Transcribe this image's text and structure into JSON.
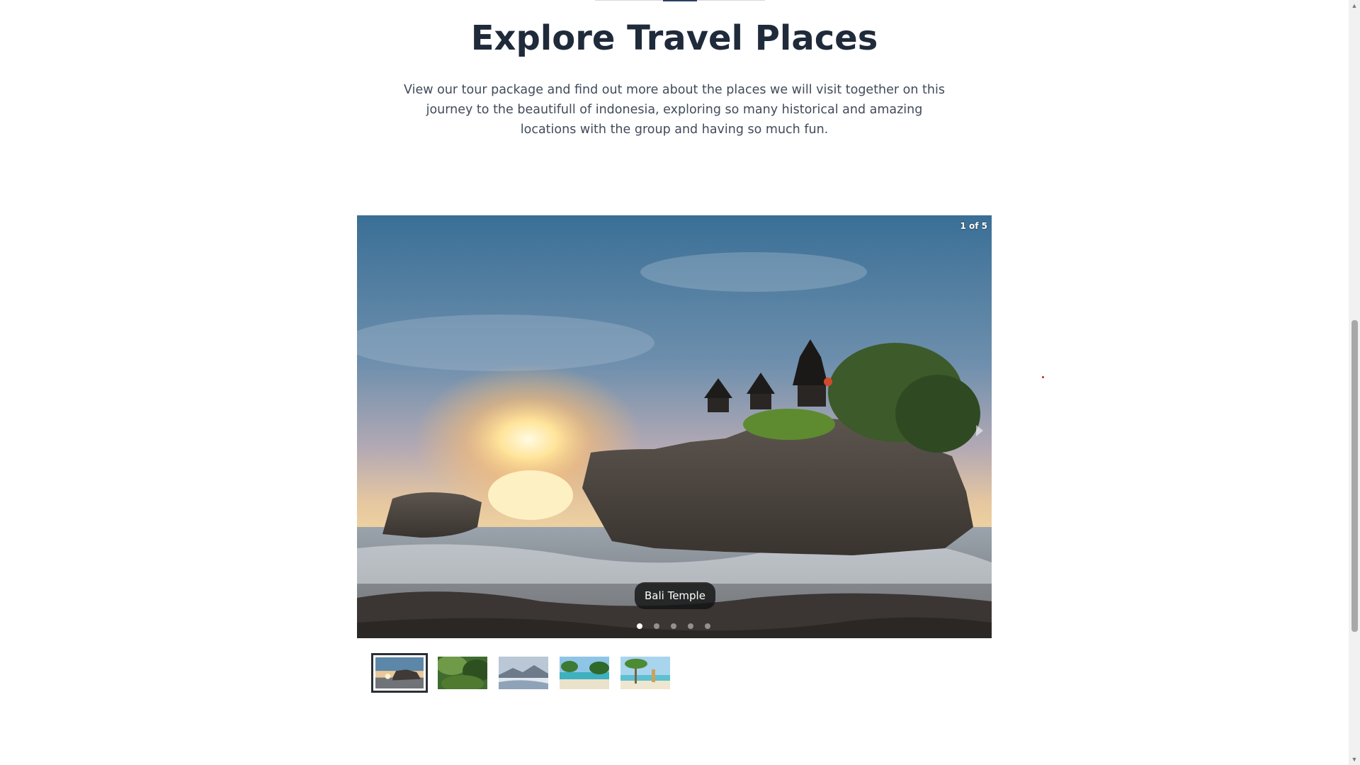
{
  "section": {
    "title": "Explore Travel Places",
    "description": "View our tour package and find out more about the places we will visit together on this journey to the beautifull of indonesia, exploring so many historical and amazing locations with the group and having so much fun."
  },
  "gallery": {
    "counter": "1 of 5",
    "current_caption": "Bali Temple",
    "current_index": 1,
    "total": 5,
    "next_icon": "chevron-right-icon"
  },
  "thumbnails": [
    {
      "name": "thumb-bali-temple",
      "active": true
    },
    {
      "name": "thumb-rainforest",
      "active": false
    },
    {
      "name": "thumb-volcano",
      "active": false
    },
    {
      "name": "thumb-beach",
      "active": false
    },
    {
      "name": "thumb-palm-beach",
      "active": false
    }
  ],
  "colors": {
    "title": "#1f2a3a",
    "text": "#414b5a",
    "caption_bg": "#141414",
    "active_thumb_border": "#2a2f36"
  }
}
